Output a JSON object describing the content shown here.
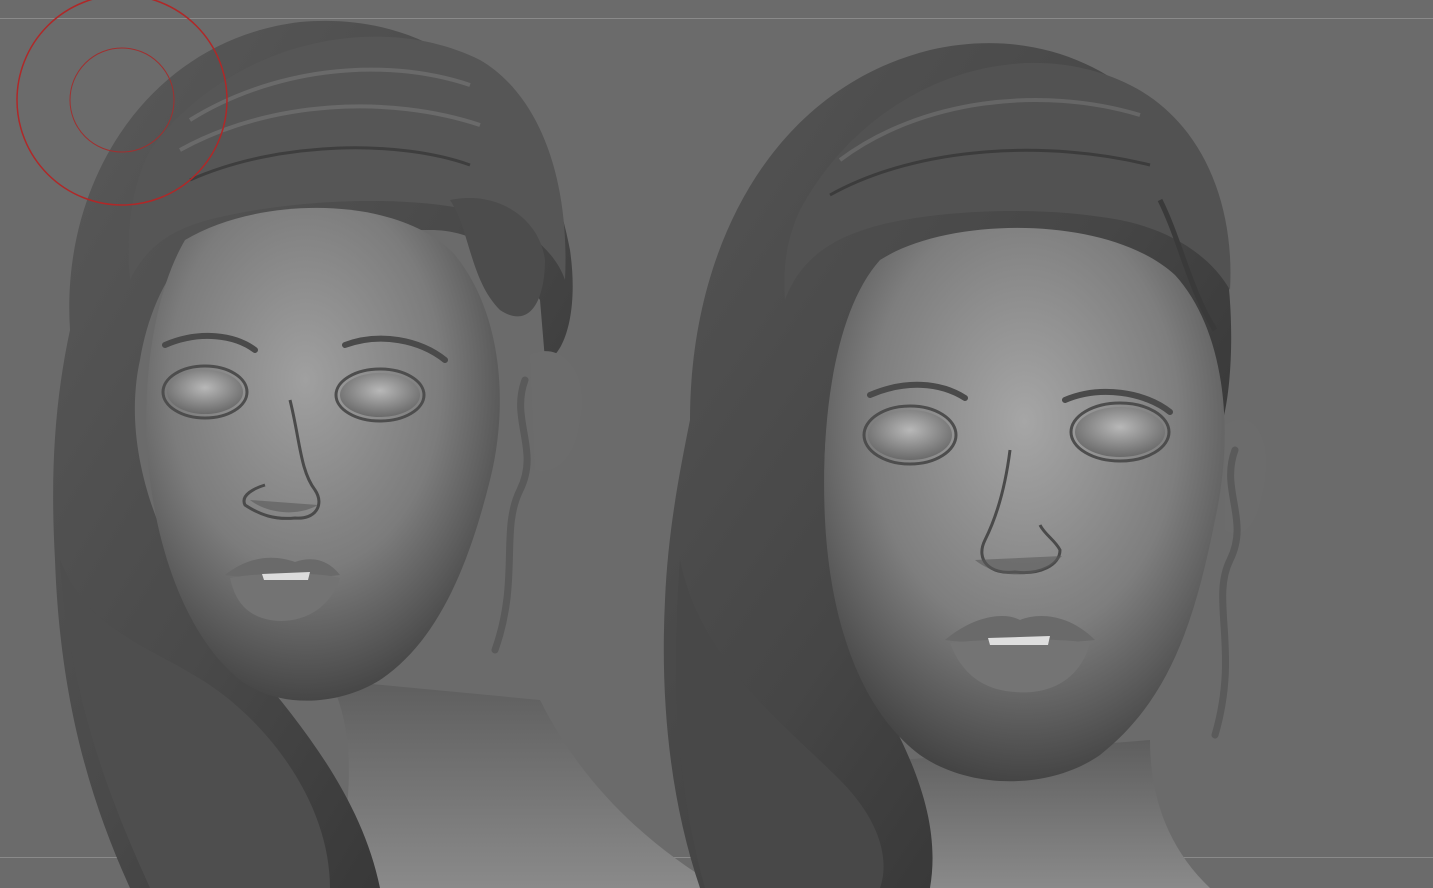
{
  "app": {
    "canvas_background": "#6b6b6b",
    "guide_color": "#8a8a8a",
    "brush_cursor_color": "#b02828"
  },
  "icons": {
    "brush_cursor": "brush-cursor-icon"
  }
}
